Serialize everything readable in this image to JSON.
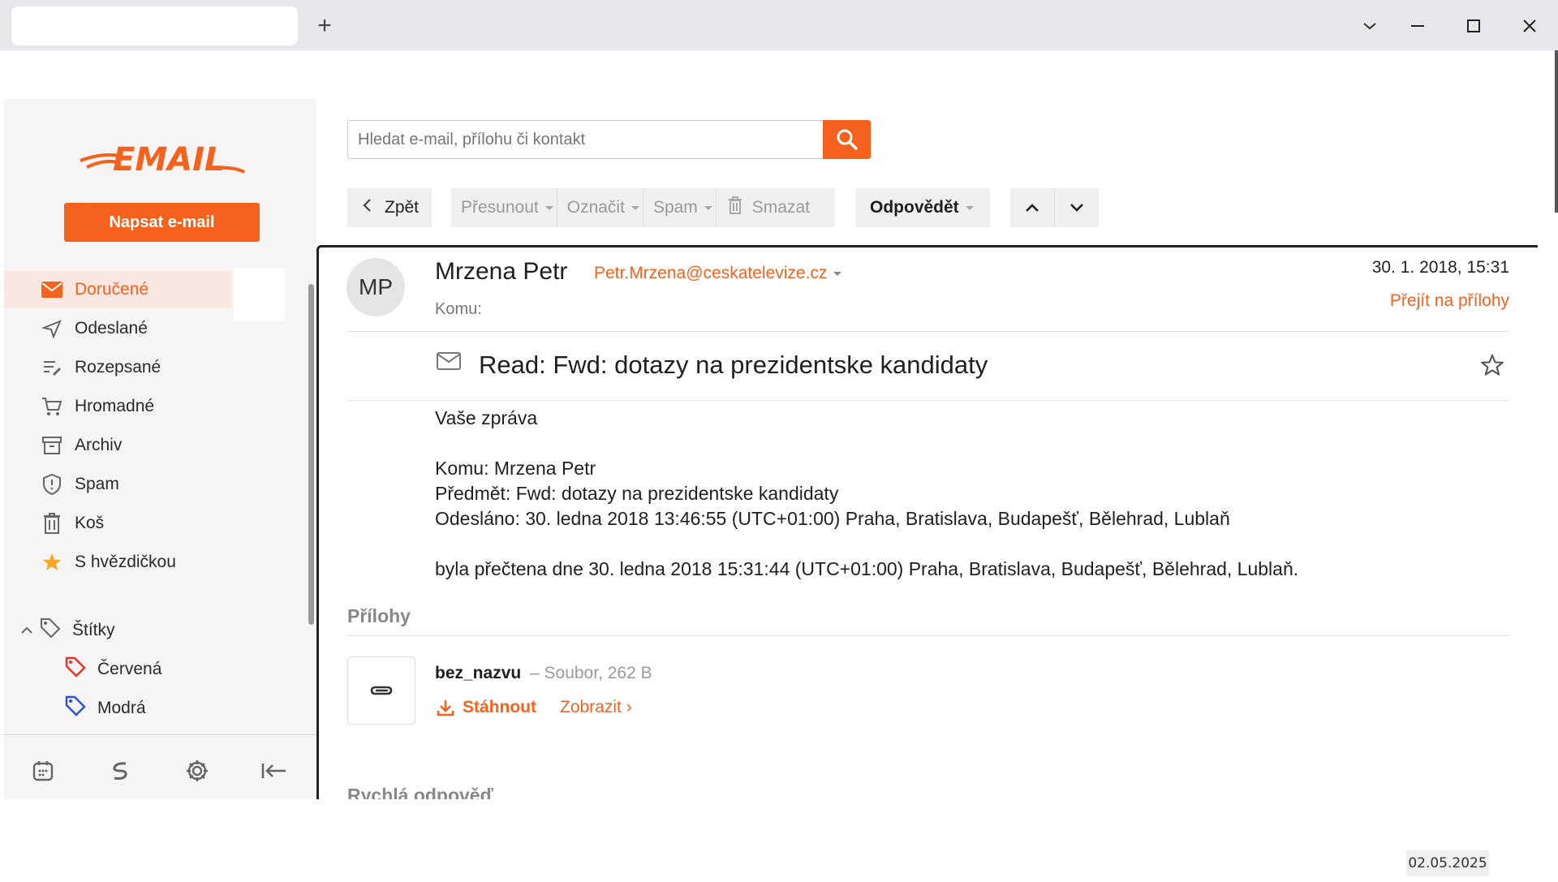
{
  "window": {
    "new_tab_symbol": "+"
  },
  "sidebar": {
    "logo_text": "EMAIL",
    "compose_label": "Napsat e-mail",
    "items": [
      {
        "label": "Doručené",
        "icon": "envelope-icon"
      },
      {
        "label": "Odeslané",
        "icon": "paper-plane-icon"
      },
      {
        "label": "Rozepsané",
        "icon": "draft-pencil-icon"
      },
      {
        "label": "Hromadné",
        "icon": "shopping-cart-icon"
      },
      {
        "label": "Archiv",
        "icon": "archive-box-icon"
      },
      {
        "label": "Spam",
        "icon": "shield-icon"
      },
      {
        "label": "Koš",
        "icon": "trash-icon"
      },
      {
        "label": "S hvězdičkou",
        "icon": "star-icon"
      }
    ],
    "labels_header": "Štítky",
    "labels": [
      {
        "label": "Červená",
        "color": "#e5322d"
      },
      {
        "label": "Modrá",
        "color": "#2b4fd6"
      }
    ],
    "footer_icons": [
      "calendar-icon",
      "s-logo-icon",
      "settings-gear-icon",
      "collapse-sidebar-icon"
    ]
  },
  "search": {
    "placeholder": "Hledat e-mail, přílohu či kontakt"
  },
  "toolbar": {
    "back_label": "Zpět",
    "move_label": "Přesunout",
    "mark_label": "Označit",
    "spam_label": "Spam",
    "delete_label": "Smazat",
    "reply_label": "Odpovědět"
  },
  "message": {
    "avatar_initials": "MP",
    "sender_name": "Mrzena Petr",
    "sender_email": "Petr.Mrzena@ceskatelevize.cz",
    "to_label": "Komu:",
    "date": "30. 1. 2018, 15:31",
    "goto_attachments": "Přejít na přílohy",
    "subject": "Read: Fwd: dotazy na prezidentske kandidaty",
    "body": {
      "line1": "Vaše zpráva",
      "line2": "Komu: Mrzena Petr",
      "line3": "Předmět: Fwd: dotazy na prezidentske kandidaty",
      "line4": "Odesláno: 30. ledna 2018 13:46:55 (UTC+01:00) Praha, Bratislava, Budapešť, Bělehrad, Lublaň",
      "line5": "byla přečtena dne 30. ledna 2018 15:31:44 (UTC+01:00) Praha, Bratislava, Budapešť, Bělehrad, Lublaň."
    }
  },
  "attachments": {
    "header": "Přílohy",
    "items": [
      {
        "name": "bez_nazvu",
        "meta": "– Soubor, 262 B",
        "download_label": "Stáhnout",
        "show_label": "Zobrazit ›"
      }
    ]
  },
  "quick_reply_label": "Rychlá odpověď",
  "datestamp": "02.05.2025",
  "colors": {
    "accent": "#f5621e",
    "sidebar_bg": "#f6f5f4",
    "active_bg": "#f9e8e1"
  }
}
